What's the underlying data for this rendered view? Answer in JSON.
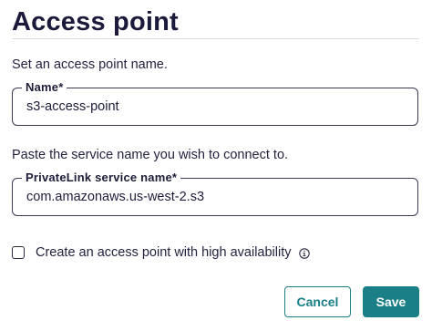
{
  "page": {
    "title": "Access point"
  },
  "name_section": {
    "helper_text": "Set an access point name.",
    "field_label": "Name*",
    "field_value": "s3-access-point"
  },
  "service_section": {
    "helper_text": "Paste the service name you wish to connect to.",
    "field_label": "PrivateLink service name*",
    "field_value": "com.amazonaws.us-west-2.s3"
  },
  "high_availability": {
    "label": "Create an access point with high availability",
    "checked": false,
    "info_icon": "info-icon"
  },
  "actions": {
    "cancel_label": "Cancel",
    "save_label": "Save"
  },
  "colors": {
    "accent": "#1a7f86",
    "title": "#1b1a3b",
    "border": "#3a3a50"
  }
}
